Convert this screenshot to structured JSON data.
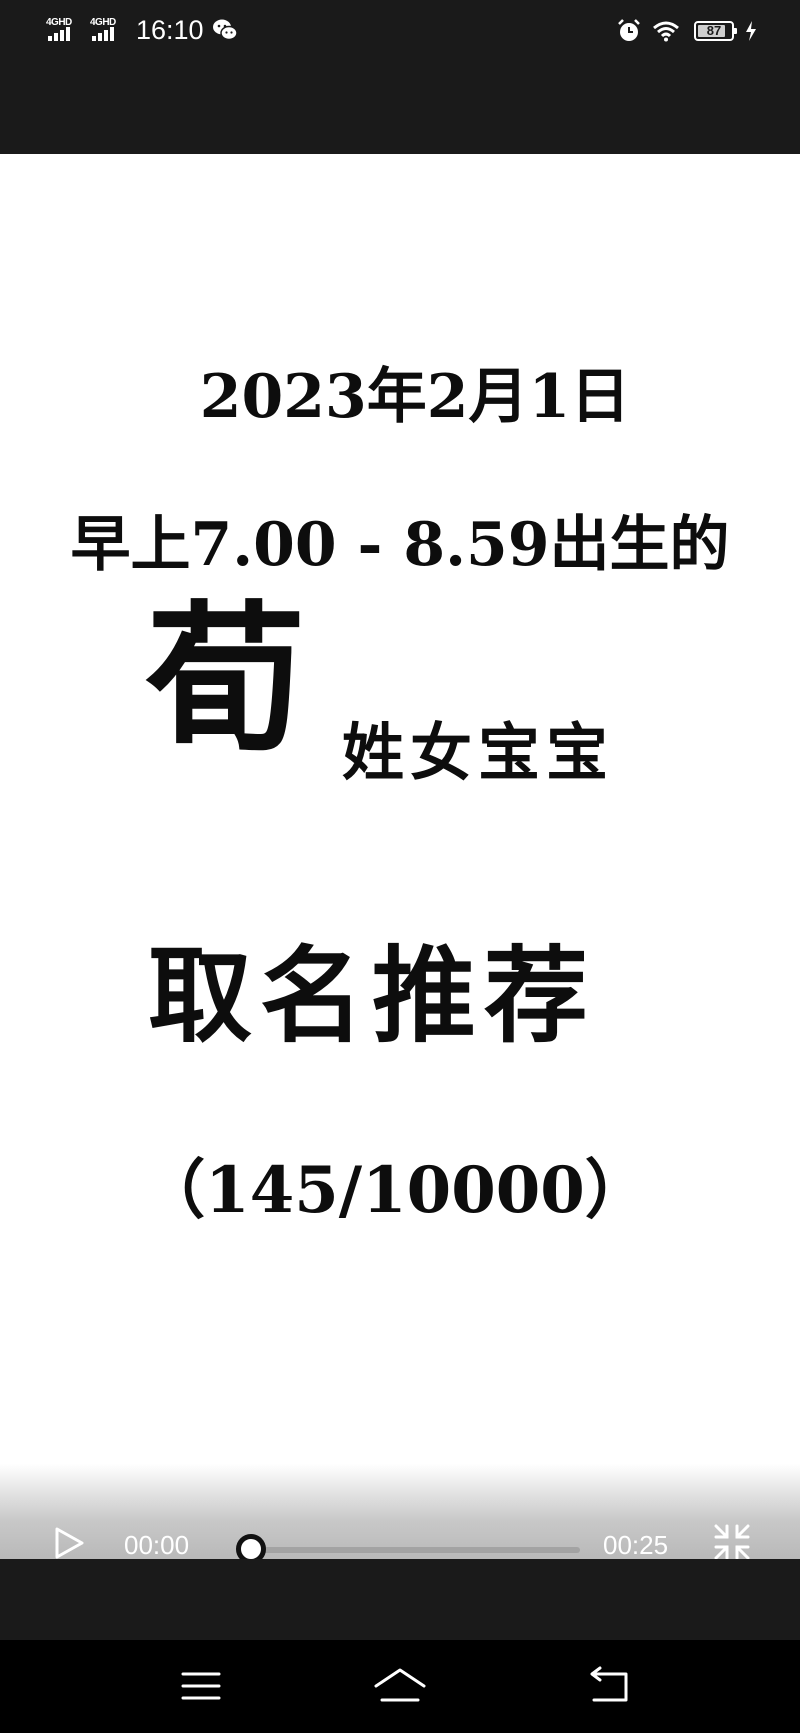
{
  "status_bar": {
    "network_1": "4GHD",
    "network_2": "4GHD",
    "time": "16:10",
    "battery": "87",
    "battery_level": 0.87
  },
  "video_content": {
    "date_line": "2023年2月1日",
    "time_line": "早上7.00 - 8.59出生的",
    "surname": "荀",
    "baby_text": "姓女宝宝",
    "recommend_text": "取名推荐",
    "count_text": "（145/10000）"
  },
  "player": {
    "current_time": "00:00",
    "duration": "00:25",
    "progress": 0.0
  },
  "icons": {
    "play": "play-icon",
    "exit_fullscreen": "exit-fullscreen-icon",
    "menu": "menu-icon",
    "home": "home-icon",
    "back": "back-icon",
    "alarm": "alarm-icon",
    "wifi": "wifi-icon",
    "wechat": "wechat-icon",
    "charging": "charging-icon"
  }
}
